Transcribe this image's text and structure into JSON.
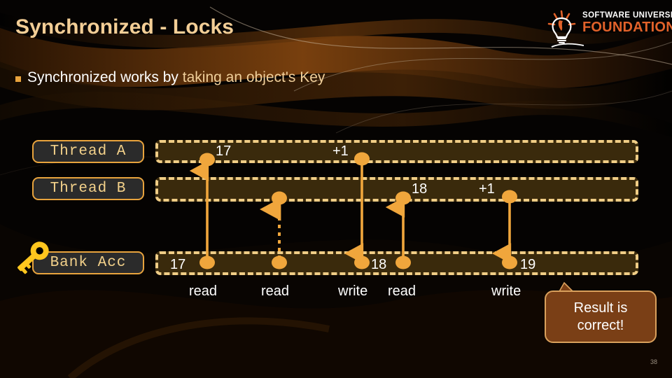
{
  "slide": {
    "title": "Synchronized - Locks",
    "bullet": {
      "marker": "square-bullet-icon",
      "text_plain": "Synchronized works by ",
      "text_highlight": "taking an object's Key"
    },
    "page_number": "38"
  },
  "logo": {
    "icon": "lightbulb-icon",
    "line1": "SOFTWARE UNIVERSITY",
    "line2": "FOUNDATION",
    "color_line2": "#e2622a"
  },
  "diagram": {
    "lanes": [
      {
        "id": "thread-a",
        "label": "Thread  A"
      },
      {
        "id": "thread-b",
        "label": "Thread  B"
      },
      {
        "id": "bank-acc",
        "label": "Bank  Acc",
        "icon": "key-icon"
      }
    ],
    "values": {
      "a_read": "17",
      "a_inc": "+1",
      "b_read": "18",
      "b_inc": "+1",
      "acc_initial": "17",
      "acc_after_a_write": "18",
      "acc_after_b_write": "19"
    },
    "operations": [
      {
        "label": "read"
      },
      {
        "label": "read"
      },
      {
        "label": "write"
      },
      {
        "label": "read"
      },
      {
        "label": "write"
      }
    ],
    "callout": {
      "line1": "Result is",
      "line2": "correct!"
    },
    "colors": {
      "accent": "#f0b45a",
      "lane_fill": "#3a2a0c",
      "lane_border": "#f0cd86",
      "label_border": "#e8a33d",
      "label_text": "#f3d18a",
      "title": "#f3ce96",
      "callout_bg": "#7a3f16"
    }
  }
}
